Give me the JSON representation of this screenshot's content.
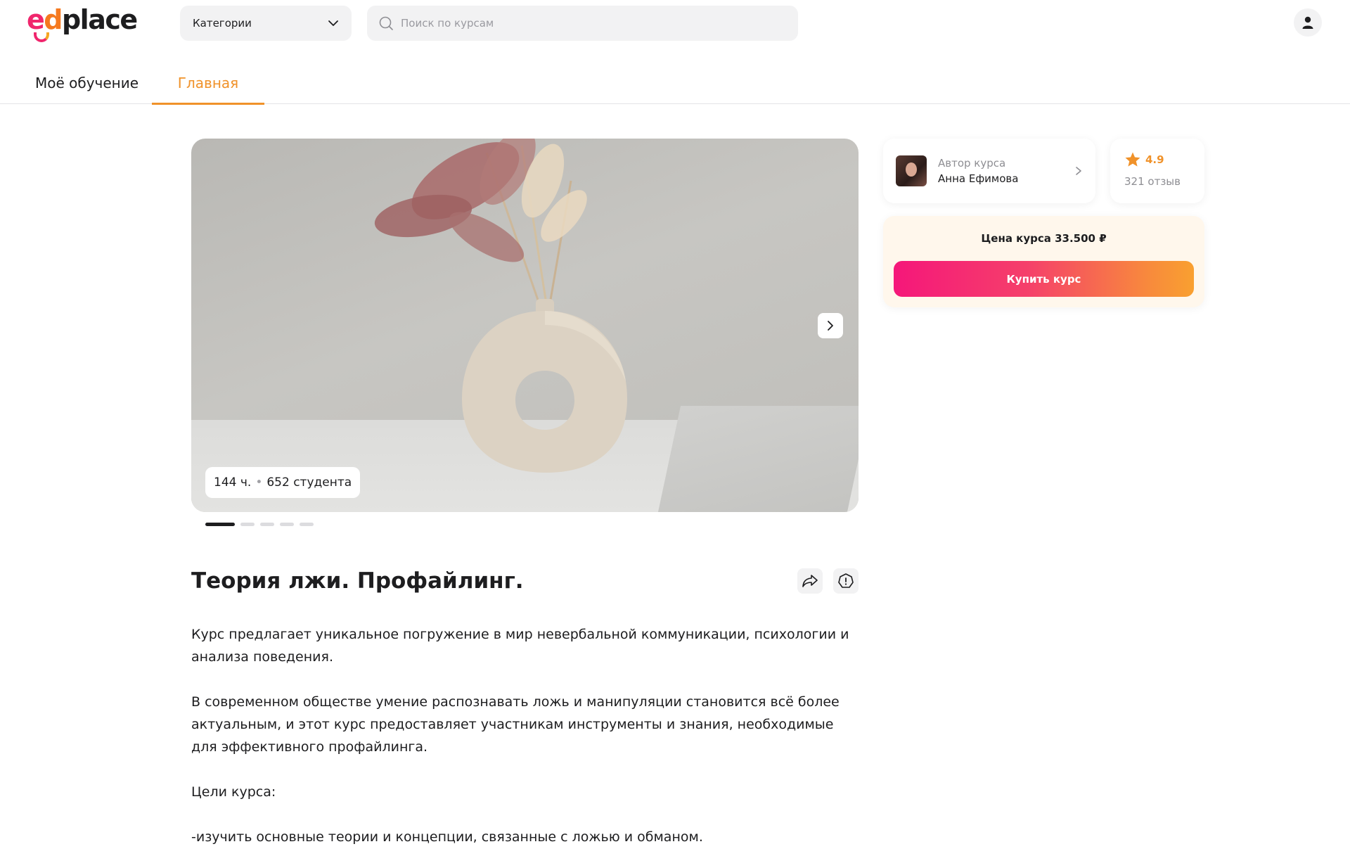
{
  "header": {
    "logo": {
      "part1": "e",
      "part2": "d",
      "part3": "place"
    },
    "categories_label": "Категории",
    "search_placeholder": "Поиск по курсам"
  },
  "tabs": [
    {
      "label": "Моё обучение",
      "active": false
    },
    {
      "label": "Главная",
      "active": true
    }
  ],
  "hero": {
    "hours": "144 ч.",
    "separator": "•",
    "students": "652 студента",
    "slides_total": 5,
    "active_slide": 1
  },
  "course": {
    "title": "Теория лжи. Профайлинг.",
    "description": [
      "Курс предлагает уникальное погружение в мир невербальной коммуникации, психологии и анализа поведения.",
      "В современном обществе умение распознавать ложь и манипуляции становится всё более актуальным, и этот курс предоставляет участникам инструменты и знания, необходимые для эффективного профайлинга.",
      "Цели курса:",
      "-изучить основные теории и концепции, связанные с ложью и обманом."
    ]
  },
  "author": {
    "label": "Автор курса",
    "name": "Анна Ефимова"
  },
  "rating": {
    "value": "4.9",
    "reviews": "321 отзыв"
  },
  "purchase": {
    "price_text": "Цена курса 33.500 ₽",
    "buy_label": "Купить курс"
  },
  "colors": {
    "accent_orange": "#f0922a",
    "brand_pink": "#f0266d",
    "cta_gradient_start": "#f5177a",
    "cta_gradient_end": "#f9a030",
    "price_card_bg": "#fff7ec"
  },
  "icons": {
    "categories": "chevron-down-icon",
    "search": "search-icon",
    "profile": "user-icon",
    "hero_next": "chevron-right-icon",
    "share": "share-icon",
    "report": "warning-icon",
    "author_arrow": "chevron-right-icon",
    "rating": "star-icon"
  }
}
